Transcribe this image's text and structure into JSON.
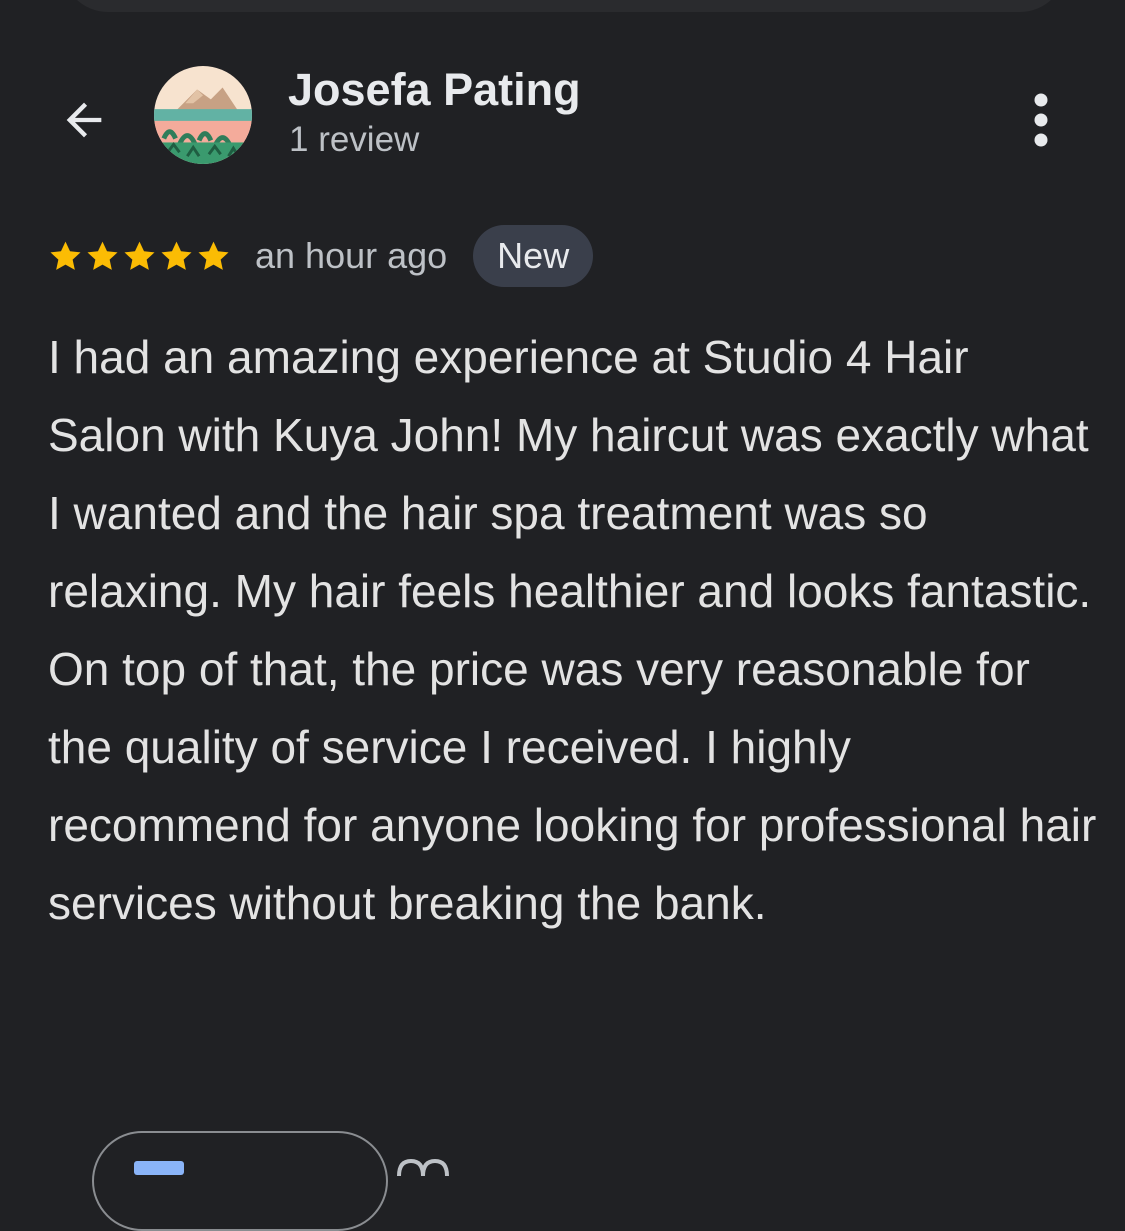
{
  "header": {
    "author_name": "Josefa Pating",
    "review_count": "1 review",
    "back_icon": "arrow-left-icon",
    "more_icon": "more-vert-icon"
  },
  "review": {
    "rating": 5,
    "max_rating": 5,
    "timestamp": "an hour ago",
    "badge": "New",
    "paragraphs": [
      "I had an amazing experience at Studio 4 Hair Salon with Kuya John! My haircut was exactly what I wanted and the hair spa treatment was so relaxing. My hair feels healthier and looks fantastic.",
      "On top of that, the price was very reasonable for the quality of service I received. I highly recommend for anyone looking for professional hair services without breaking the bank."
    ]
  },
  "colors": {
    "background": "#202124",
    "star": "#fbbc04",
    "badge_bg": "#3a3f4b",
    "text_primary": "#e8eaed",
    "text_secondary": "#bdc1c6"
  }
}
